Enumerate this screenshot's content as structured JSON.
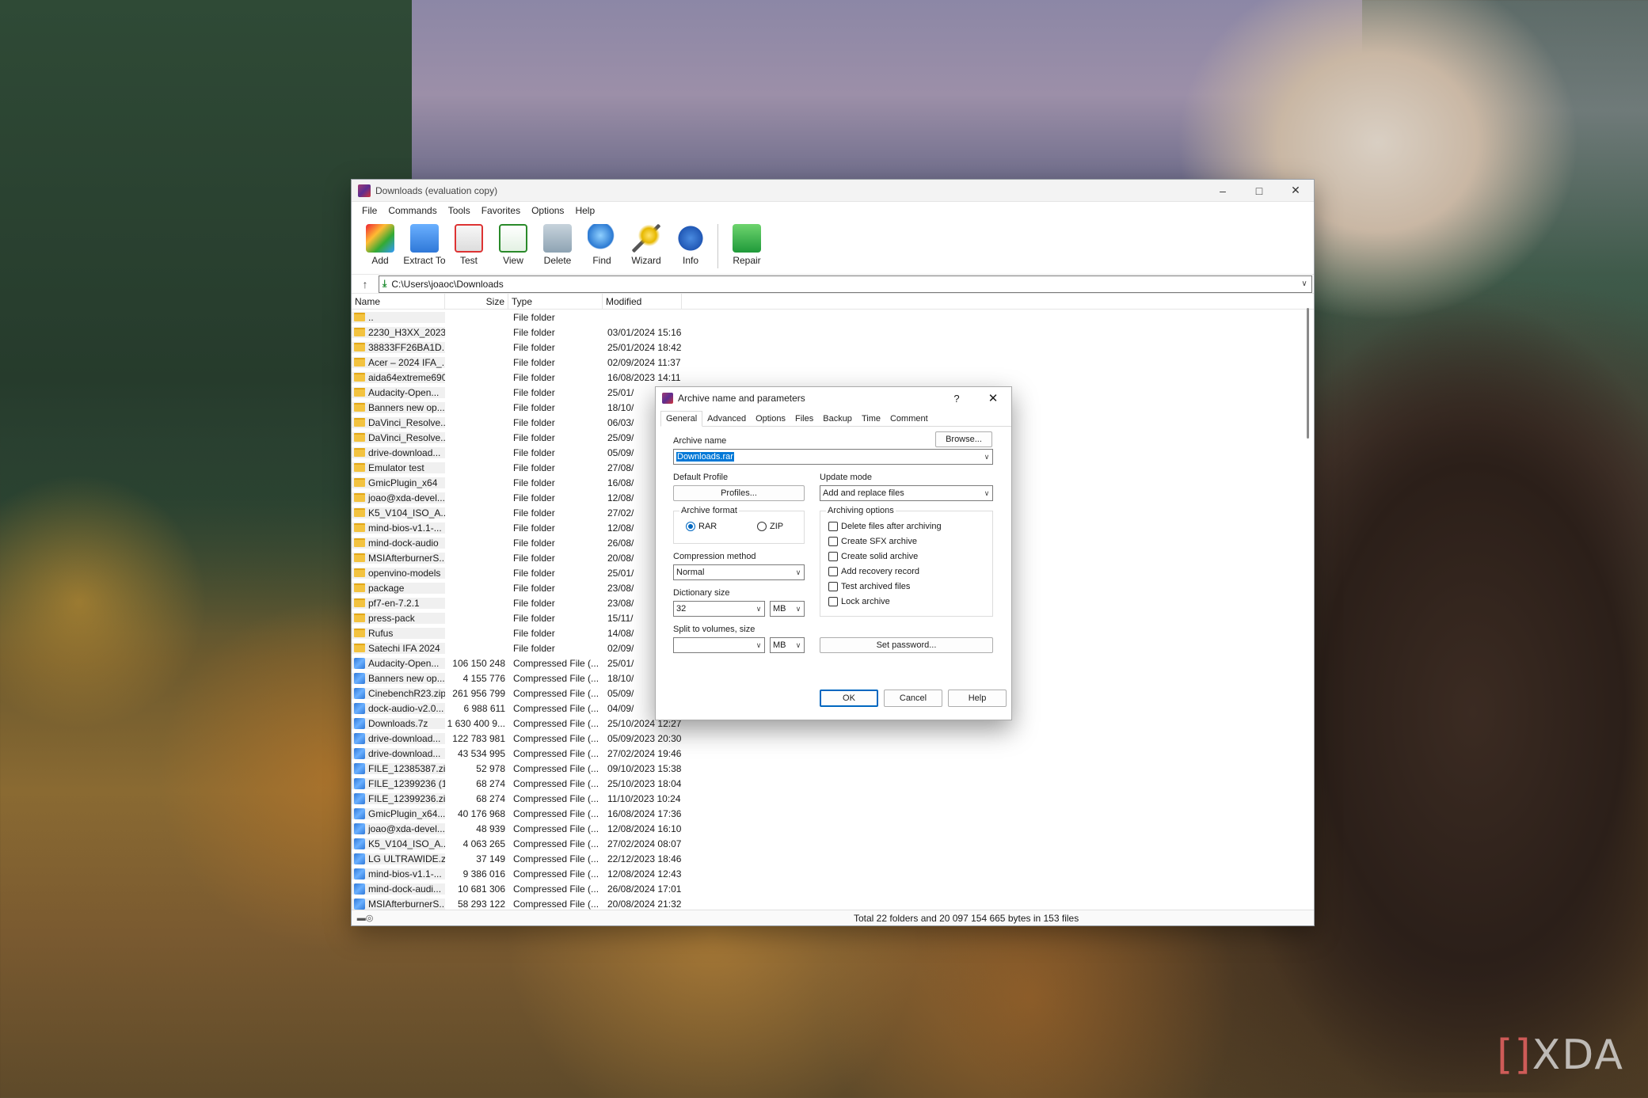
{
  "window": {
    "title": "Downloads (evaluation copy)",
    "menu": [
      "File",
      "Commands",
      "Tools",
      "Favorites",
      "Options",
      "Help"
    ],
    "toolbar": [
      "Add",
      "Extract To",
      "Test",
      "View",
      "Delete",
      "Find",
      "Wizard",
      "Info",
      "Repair"
    ],
    "address": "C:\\Users\\joaoc\\Downloads"
  },
  "columns": {
    "name": "Name",
    "size": "Size",
    "type": "Type",
    "modified": "Modified"
  },
  "files": [
    {
      "name": "..",
      "size": "",
      "type": "File folder",
      "modified": "",
      "kind": "folder"
    },
    {
      "name": "2230_H3XX_2023...",
      "size": "",
      "type": "File folder",
      "modified": "03/01/2024 15:16",
      "kind": "folder"
    },
    {
      "name": "38833FF26BA1D....",
      "size": "",
      "type": "File folder",
      "modified": "25/01/2024 18:42",
      "kind": "folder"
    },
    {
      "name": "Acer – 2024 IFA_...",
      "size": "",
      "type": "File folder",
      "modified": "02/09/2024 11:37",
      "kind": "folder"
    },
    {
      "name": "aida64extreme690",
      "size": "",
      "type": "File folder",
      "modified": "16/08/2023 14:11",
      "kind": "folder"
    },
    {
      "name": "Audacity-Open...",
      "size": "",
      "type": "File folder",
      "modified": "25/01/",
      "kind": "folder"
    },
    {
      "name": "Banners new op...",
      "size": "",
      "type": "File folder",
      "modified": "18/10/",
      "kind": "folder"
    },
    {
      "name": "DaVinci_Resolve...",
      "size": "",
      "type": "File folder",
      "modified": "06/03/",
      "kind": "folder"
    },
    {
      "name": "DaVinci_Resolve...",
      "size": "",
      "type": "File folder",
      "modified": "25/09/",
      "kind": "folder"
    },
    {
      "name": "drive-download...",
      "size": "",
      "type": "File folder",
      "modified": "05/09/",
      "kind": "folder"
    },
    {
      "name": "Emulator test",
      "size": "",
      "type": "File folder",
      "modified": "27/08/",
      "kind": "folder"
    },
    {
      "name": "GmicPlugin_x64",
      "size": "",
      "type": "File folder",
      "modified": "16/08/",
      "kind": "folder"
    },
    {
      "name": "joao@xda-devel...",
      "size": "",
      "type": "File folder",
      "modified": "12/08/",
      "kind": "folder"
    },
    {
      "name": "K5_V104_ISO_A...",
      "size": "",
      "type": "File folder",
      "modified": "27/02/",
      "kind": "folder"
    },
    {
      "name": "mind-bios-v1.1-...",
      "size": "",
      "type": "File folder",
      "modified": "12/08/",
      "kind": "folder"
    },
    {
      "name": "mind-dock-audio",
      "size": "",
      "type": "File folder",
      "modified": "26/08/",
      "kind": "folder"
    },
    {
      "name": "MSIAfterburnerS...",
      "size": "",
      "type": "File folder",
      "modified": "20/08/",
      "kind": "folder"
    },
    {
      "name": "openvino-models",
      "size": "",
      "type": "File folder",
      "modified": "25/01/",
      "kind": "folder"
    },
    {
      "name": "package",
      "size": "",
      "type": "File folder",
      "modified": "23/08/",
      "kind": "folder"
    },
    {
      "name": "pf7-en-7.2.1",
      "size": "",
      "type": "File folder",
      "modified": "23/08/",
      "kind": "folder"
    },
    {
      "name": "press-pack",
      "size": "",
      "type": "File folder",
      "modified": "15/11/",
      "kind": "folder"
    },
    {
      "name": "Rufus",
      "size": "",
      "type": "File folder",
      "modified": "14/08/",
      "kind": "folder"
    },
    {
      "name": "Satechi IFA 2024",
      "size": "",
      "type": "File folder",
      "modified": "02/09/",
      "kind": "folder"
    },
    {
      "name": "Audacity-Open...",
      "size": "106 150 248",
      "type": "Compressed File (...",
      "modified": "25/01/",
      "kind": "archive"
    },
    {
      "name": "Banners new op...",
      "size": "4 155 776",
      "type": "Compressed File (...",
      "modified": "18/10/",
      "kind": "archive"
    },
    {
      "name": "CinebenchR23.zip",
      "size": "261 956 799",
      "type": "Compressed File (...",
      "modified": "05/09/",
      "kind": "archive"
    },
    {
      "name": "dock-audio-v2.0...",
      "size": "6 988 611",
      "type": "Compressed File (...",
      "modified": "04/09/",
      "kind": "archive"
    },
    {
      "name": "Downloads.7z",
      "size": "1 630 400 9...",
      "type": "Compressed File (...",
      "modified": "25/10/2024 12:27",
      "kind": "archive"
    },
    {
      "name": "drive-download...",
      "size": "122 783 981",
      "type": "Compressed File (...",
      "modified": "05/09/2023 20:30",
      "kind": "archive"
    },
    {
      "name": "drive-download...",
      "size": "43 534 995",
      "type": "Compressed File (...",
      "modified": "27/02/2024 19:46",
      "kind": "archive"
    },
    {
      "name": "FILE_12385387.zip",
      "size": "52 978",
      "type": "Compressed File (...",
      "modified": "09/10/2023 15:38",
      "kind": "archive"
    },
    {
      "name": "FILE_12399236 (1...",
      "size": "68 274",
      "type": "Compressed File (...",
      "modified": "25/10/2023 18:04",
      "kind": "archive"
    },
    {
      "name": "FILE_12399236.zip",
      "size": "68 274",
      "type": "Compressed File (...",
      "modified": "11/10/2023 10:24",
      "kind": "archive"
    },
    {
      "name": "GmicPlugin_x64...",
      "size": "40 176 968",
      "type": "Compressed File (...",
      "modified": "16/08/2024 17:36",
      "kind": "archive"
    },
    {
      "name": "joao@xda-devel...",
      "size": "48 939",
      "type": "Compressed File (...",
      "modified": "12/08/2024 16:10",
      "kind": "archive"
    },
    {
      "name": "K5_V104_ISO_A...",
      "size": "4 063 265",
      "type": "Compressed File (...",
      "modified": "27/02/2024 08:07",
      "kind": "archive"
    },
    {
      "name": "LG ULTRAWIDE.z...",
      "size": "37 149",
      "type": "Compressed File (...",
      "modified": "22/12/2023 18:46",
      "kind": "archive"
    },
    {
      "name": "mind-bios-v1.1-...",
      "size": "9 386 016",
      "type": "Compressed File (...",
      "modified": "12/08/2024 12:43",
      "kind": "archive"
    },
    {
      "name": "mind-dock-audi...",
      "size": "10 681 306",
      "type": "Compressed File (...",
      "modified": "26/08/2024 17:01",
      "kind": "archive"
    },
    {
      "name": "MSIAfterburnerS...",
      "size": "58 293 122",
      "type": "Compressed File (...",
      "modified": "20/08/2024 21:32",
      "kind": "archive"
    }
  ],
  "status": "Total 22 folders and 20 097 154 665 bytes in 153 files",
  "dialog": {
    "title": "Archive name and parameters",
    "help": "?",
    "tabs": [
      "General",
      "Advanced",
      "Options",
      "Files",
      "Backup",
      "Time",
      "Comment"
    ],
    "archive_name_label": "Archive name",
    "browse": "Browse...",
    "archive_name_value": "Downloads.rar",
    "default_profile_label": "Default Profile",
    "profiles": "Profiles...",
    "update_mode_label": "Update mode",
    "update_mode_value": "Add and replace files",
    "archive_format_label": "Archive format",
    "format_rar": "RAR",
    "format_zip": "ZIP",
    "compression_label": "Compression method",
    "compression_value": "Normal",
    "dictionary_label": "Dictionary size",
    "dictionary_value": "32",
    "dictionary_unit": "MB",
    "split_label": "Split to volumes, size",
    "split_unit": "MB",
    "archiving_options_label": "Archiving options",
    "options": [
      "Delete files after archiving",
      "Create SFX archive",
      "Create solid archive",
      "Add recovery record",
      "Test archived files",
      "Lock archive"
    ],
    "set_password": "Set password...",
    "ok": "OK",
    "cancel": "Cancel",
    "help_btn": "Help"
  },
  "watermark": "XDA"
}
